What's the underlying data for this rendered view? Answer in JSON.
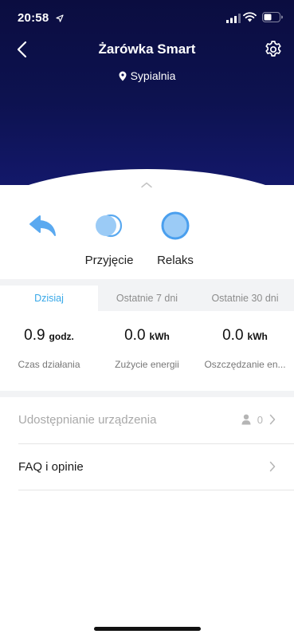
{
  "status_bar": {
    "time": "20:58"
  },
  "header": {
    "title": "Żarówka Smart",
    "location": "Sypialnia"
  },
  "scenes": [
    {
      "label": "",
      "icon": "share-arrow-icon"
    },
    {
      "label": "Przyjęcie",
      "icon": "party-toggle-icon"
    },
    {
      "label": "Relaks",
      "icon": "relax-circle-icon"
    }
  ],
  "tabs": [
    {
      "label": "Dzisiaj",
      "active": true
    },
    {
      "label": "Ostatnie 7 dni",
      "active": false
    },
    {
      "label": "Ostatnie 30 dni",
      "active": false
    }
  ],
  "stats": [
    {
      "value": "0.9",
      "unit": "godz.",
      "label": "Czas działania"
    },
    {
      "value": "0.0",
      "unit": "kWh",
      "label": "Zużycie energii"
    },
    {
      "value": "0.0",
      "unit": "kWh",
      "label": "Oszczędzanie en..."
    }
  ],
  "rows": {
    "sharing": {
      "label": "Udostępnianie urządzenia",
      "count": "0"
    },
    "faq": {
      "label": "FAQ i opinie"
    }
  },
  "colors": {
    "header_bg": "#0d1250",
    "accent": "#37a8e8",
    "scene_icon": "#5aa9f0",
    "disabled_text": "#a9a9a9"
  }
}
